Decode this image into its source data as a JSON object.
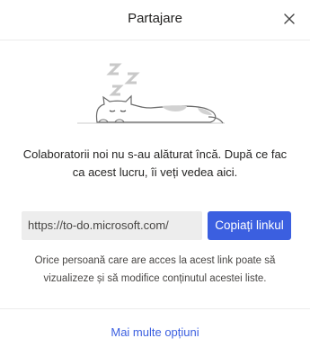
{
  "header": {
    "title": "Partajare",
    "close_icon": "close-icon"
  },
  "illustration": {
    "icon": "sleeping-cat-icon",
    "z_letters": [
      "Z",
      "Z",
      "Z"
    ]
  },
  "empty_state": {
    "message": "Colaboratorii noi nu s-au alăturat încă. După ce fac ca acest lucru, îi veți vedea aici."
  },
  "share_link": {
    "url": "https://to-do.microsoft.com/",
    "copy_label": "Copiați linkul"
  },
  "note": "Orice persoană care are acces la acest link poate să vizualizeze și să modifice conținutul acestei liste.",
  "footer": {
    "more_options_label": "Mai multe opțiuni"
  },
  "colors": {
    "accent": "#3b5fe0",
    "link_field_bg": "#ededed"
  }
}
